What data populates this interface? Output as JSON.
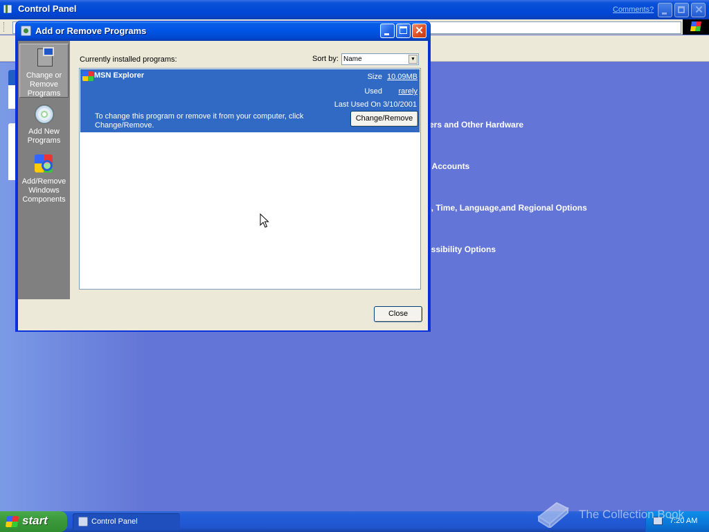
{
  "control_panel": {
    "title": "Control Panel",
    "comments_link": "Comments?",
    "categories": [
      "ters and Other Hardware",
      "r Accounts",
      "e, Time, Language,and Regional Options",
      "essibility Options"
    ]
  },
  "dialog": {
    "title": "Add or Remove Programs",
    "sidebar": [
      {
        "label": "Change or Remove Programs",
        "icon": "change-remove-programs-icon",
        "selected": true
      },
      {
        "label": "Add New Programs",
        "icon": "cd-icon",
        "selected": false
      },
      {
        "label": "Add/Remove Windows Components",
        "icon": "windows-components-icon",
        "selected": false
      }
    ],
    "installed_label": "Currently installed programs:",
    "sort_by_label": "Sort by:",
    "sort_by_value": "Name",
    "program": {
      "name": "MSN Explorer",
      "size_label": "Size",
      "size_value": "10.09MB",
      "used_label": "Used",
      "used_value": "rarely",
      "last_used": "Last Used On 3/10/2001",
      "description": "To change this program or remove it from your computer, click Change/Remove.",
      "change_button": "Change/Remove"
    },
    "close_button": "Close"
  },
  "taskbar": {
    "start": "start",
    "task_label": "Control Panel",
    "clock": "7:20 AM"
  },
  "watermark": "The Collection Book",
  "colors": {
    "desktop_blue": "#6375d6",
    "selection_blue": "#316ac5",
    "titlebar_blue": "#0054e3",
    "start_green": "#3c9a3c"
  }
}
